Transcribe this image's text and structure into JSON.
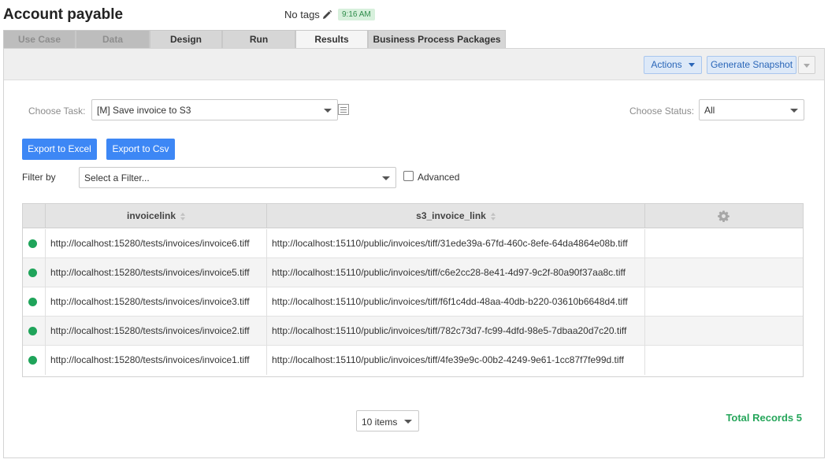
{
  "header": {
    "title": "Account payable",
    "tags_text": "No tags",
    "time_badge": "9:16 AM"
  },
  "tabs": [
    {
      "label": "Use Case",
      "state": "disabled"
    },
    {
      "label": "Data",
      "state": "disabled"
    },
    {
      "label": "Design",
      "state": "normal"
    },
    {
      "label": "Run",
      "state": "normal"
    },
    {
      "label": "Results",
      "state": "active"
    },
    {
      "label": "Business Process Packages",
      "state": "normal"
    }
  ],
  "toolbar": {
    "actions_label": "Actions",
    "snapshot_label": "Generate Snapshot"
  },
  "task": {
    "label": "Choose Task:",
    "value": "[M] Save invoice to S3"
  },
  "status": {
    "label": "Choose Status:",
    "value": "All"
  },
  "export": {
    "excel_label": "Export to Excel",
    "csv_label": "Export to Csv"
  },
  "filter": {
    "label": "Filter by",
    "placeholder": "Select a Filter...",
    "advanced_label": "Advanced"
  },
  "table": {
    "columns": [
      "invoicelink",
      "s3_invoice_link"
    ],
    "rows": [
      {
        "status": "success",
        "invoicelink": "http://localhost:15280/tests/invoices/invoice6.tiff",
        "s3_invoice_link": "http://localhost:15110/public/invoices/tiff/31ede39a-67fd-460c-8efe-64da4864e08b.tiff"
      },
      {
        "status": "success",
        "invoicelink": "http://localhost:15280/tests/invoices/invoice5.tiff",
        "s3_invoice_link": "http://localhost:15110/public/invoices/tiff/c6e2cc28-8e41-4d97-9c2f-80a90f37aa8c.tiff"
      },
      {
        "status": "success",
        "invoicelink": "http://localhost:15280/tests/invoices/invoice3.tiff",
        "s3_invoice_link": "http://localhost:15110/public/invoices/tiff/f6f1c4dd-48aa-40db-b220-03610b6648d4.tiff"
      },
      {
        "status": "success",
        "invoicelink": "http://localhost:15280/tests/invoices/invoice2.tiff",
        "s3_invoice_link": "http://localhost:15110/public/invoices/tiff/782c73d7-fc99-4dfd-98e5-7dbaa20d7c20.tiff"
      },
      {
        "status": "success",
        "invoicelink": "http://localhost:15280/tests/invoices/invoice1.tiff",
        "s3_invoice_link": "http://localhost:15110/public/invoices/tiff/4fe39e9c-00b2-4249-9e61-1cc87f7fe99d.tiff"
      }
    ]
  },
  "pager": {
    "page_size": "10 items"
  },
  "total": "Total Records 5",
  "colors": {
    "primary_blue": "#3d87f5",
    "success_green": "#1fa45a",
    "total_green": "#26a65b"
  }
}
